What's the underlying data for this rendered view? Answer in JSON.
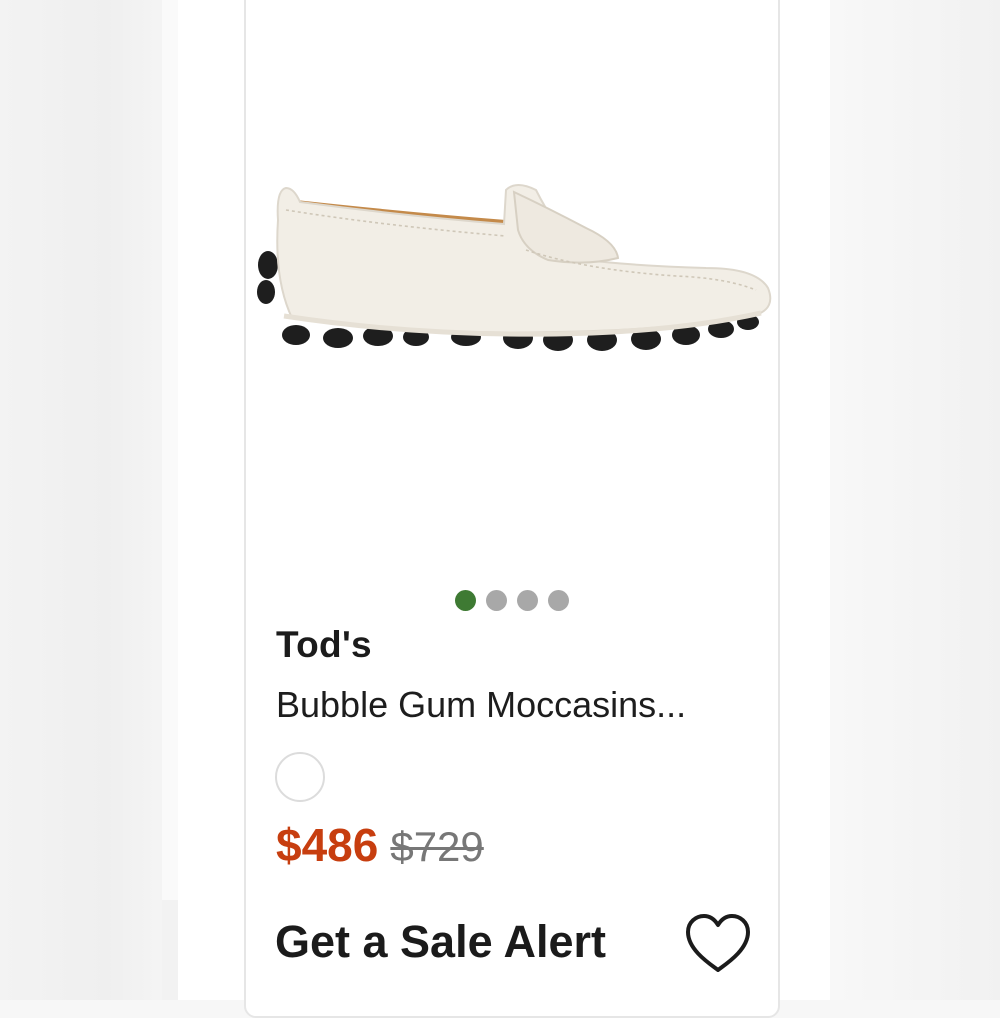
{
  "product": {
    "brand": "Tod's",
    "title": "Bubble Gum Moccasins...",
    "sale_price": "$486",
    "original_price": "$729",
    "image_count": 4,
    "active_image_index": 0,
    "color_swatch": "#ffffff"
  },
  "actions": {
    "sale_alert_label": "Get a Sale Alert",
    "favorite_icon": "heart-icon"
  },
  "colors": {
    "sale_price": "#c73e0f",
    "active_dot": "#3e7a33",
    "inactive_dot": "#a8a8a8"
  }
}
